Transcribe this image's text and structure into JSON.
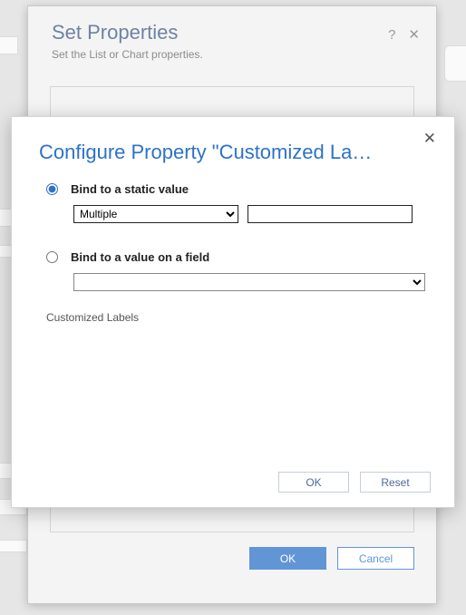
{
  "outer": {
    "title": "Set Properties",
    "subtitle": "Set the List or Chart properties.",
    "help": "?",
    "close": "✕",
    "ok": "OK",
    "cancel": "Cancel"
  },
  "inner": {
    "title": "Configure Property \"Customized La…",
    "close": "✕",
    "radio_static_label": "Bind to a static value",
    "radio_field_label": "Bind to a value on a field",
    "static_select_value": "Multiple",
    "static_text_value": "",
    "field_select_value": "",
    "customized_labels": "Customized Labels",
    "ok": "OK",
    "reset": "Reset"
  }
}
